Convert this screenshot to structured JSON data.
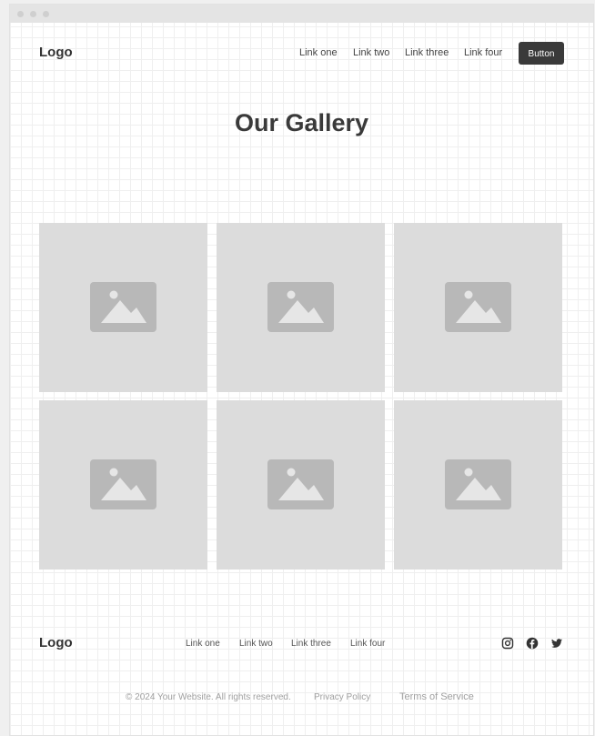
{
  "header": {
    "logo": "Logo",
    "links": [
      "Link one",
      "Link two",
      "Link three",
      "Link four"
    ],
    "button_label": "Button"
  },
  "main": {
    "title": "Our Gallery",
    "tiles": [
      "image-placeholder",
      "image-placeholder",
      "image-placeholder",
      "image-placeholder",
      "image-placeholder",
      "image-placeholder"
    ]
  },
  "footer": {
    "logo": "Logo",
    "links": [
      "Link one",
      "Link two",
      "Link three",
      "Link four"
    ],
    "social_icons": [
      "instagram-icon",
      "facebook-icon",
      "twitter-icon"
    ],
    "copyright": "© 2024 Your Website. All rights reserved.",
    "privacy_label": "Privacy Policy",
    "terms_label": "Terms of Service"
  },
  "colors": {
    "button_bg": "#3a3a3a",
    "tile_bg": "#dcdcdc",
    "tile_icon": "#b8b8b8"
  }
}
